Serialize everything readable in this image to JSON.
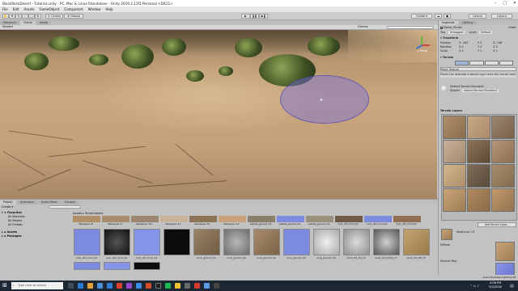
{
  "window": {
    "title": "BlackRockDesert - Tutorial.unity - PC, Mac & Linux Standalone - Unity 2019.2.11f1 Personal <DX11>"
  },
  "menubar": {
    "items": [
      "File",
      "Edit",
      "Assets",
      "GameObject",
      "Component",
      "Window",
      "Help"
    ]
  },
  "toolbar": {
    "center_label": "Center",
    "global_label": "Global",
    "collab_label": "Collab ▾",
    "layers_label": "Layers",
    "layout_label": "Layout"
  },
  "scene_tabs": [
    "Hierarchy",
    "Scene",
    "Game"
  ],
  "scene_toolbar": {
    "shaded_label": "Shaded",
    "gizmos_label": "Gizmos",
    "persp_label": "< Persp"
  },
  "inspector": {
    "tabs": [
      "Inspector",
      "Lighting"
    ],
    "object_name": "Demo_Terrain",
    "static_label": "Static",
    "tag_label": "Tag",
    "tag_value": "Untagged",
    "layer_label": "Layer",
    "layer_value": "Default",
    "transform_title": "Transform",
    "rows": [
      {
        "label": "Position",
        "values": [
          "X -263",
          "Y 0",
          "Z -148"
        ]
      },
      {
        "label": "Rotation",
        "values": [
          "X 0",
          "Y 0",
          "Z 0"
        ]
      },
      {
        "label": "Scale",
        "values": [
          "X 1",
          "Y 1",
          "Z 1"
        ]
      }
    ],
    "terrain_title": "Terrain",
    "paint_mode": "Paint Texture",
    "paint_hint": "Paints the selected material layer onto the terrain texture",
    "material_name": "Default-Terrain-Standard",
    "shader_label": "Shader",
    "shader_value": "Nature/Terrain/Standard",
    "layers_title": "Terrain Layers",
    "add_layer_button": "Add Terrain Layer...",
    "selected_layer": "NewLayer 13",
    "diffuse_label": "Diffuse",
    "normal_map_label": "Normal Map",
    "footer": "Auto Generate Lighting Off"
  },
  "bottom_tabs": [
    "Project",
    "Animation",
    "Audio Mixer",
    "Console"
  ],
  "project": {
    "create_label": "Create ▾",
    "favorites_label": "Favorites",
    "favorites": [
      "All Materials",
      "All Models",
      "All Prefabs"
    ],
    "assets_label": "Assets",
    "packages_label": "Packages",
    "breadcrumb": [
      "Assets",
      "TerrainAssets"
    ],
    "row1": [
      "NewLayer 8",
      "NewLayer 9",
      "NewLayer 10",
      "NewLayer 11",
      "NewLayer 12",
      "NewLayer 13",
      "pebble_ground_01",
      "pebble_ground_01",
      "pebble_ground_01",
      "rock_dirt_mud_01",
      "rock_dirt_mud_01",
      "rock_dirt_mud_01"
    ],
    "row2": [
      "rock_dirt_mud_01",
      "rock_dirt_mud_01",
      "rock_dirt_mud_01",
      "rock_ground_01",
      "rock_ground_02",
      "rock_ground_02",
      "rock_ground_02",
      "rock_ground_02",
      "sand_03_AO_Hi",
      "sand_03_bump_Hi",
      "sand_03_diff_Hi"
    ]
  },
  "taskbar": {
    "search_placeholder": "Type here to search",
    "time": "4:06 PM",
    "date": "5/2/2020"
  }
}
